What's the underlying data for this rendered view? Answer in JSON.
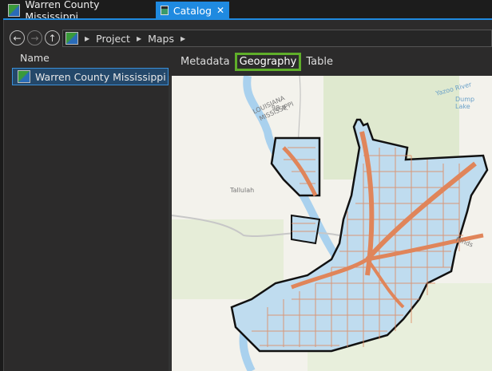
{
  "tabs": [
    {
      "label": "Warren County Mississippi",
      "icon": "map-layer-icon",
      "active": false
    },
    {
      "label": "Catalog",
      "icon": "catalog-icon",
      "active": true,
      "close": "✕"
    }
  ],
  "nav": {
    "back": "←",
    "forward": "→",
    "up": "↑",
    "breadcrumb": [
      "Project",
      "Maps"
    ]
  },
  "contents": {
    "header": "Name",
    "items": [
      {
        "label": "Warren County Mississippi",
        "selected": true
      }
    ]
  },
  "view_tabs": [
    {
      "label": "Metadata"
    },
    {
      "label": "Geography",
      "active": true
    },
    {
      "label": "Table"
    }
  ],
  "map": {
    "labels": {
      "state1": "LOUISIANA",
      "state2": "MISSISSIPPI",
      "elev": "98 ft.",
      "river": "Yazoo River",
      "lake": "Dump Lake",
      "town": "Tallulah",
      "county": "Hinds"
    }
  },
  "colors": {
    "accent": "#1f8ae0",
    "active_tab_border": "#5fae2a",
    "roads": "#e0855a",
    "water": "#b9daf0"
  }
}
